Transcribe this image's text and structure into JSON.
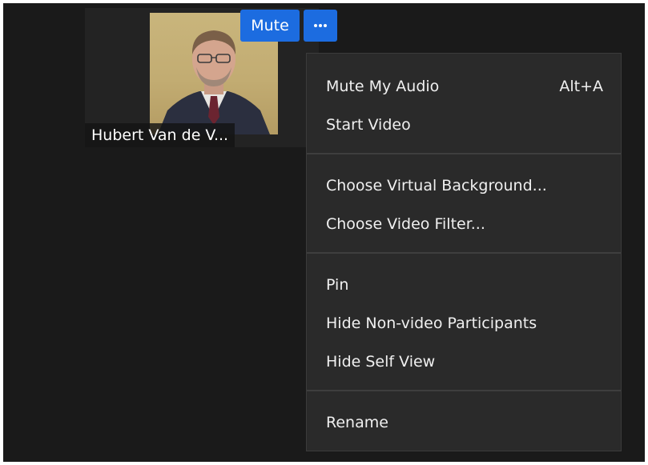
{
  "participant": {
    "name": "Hubert Van de V..."
  },
  "controls": {
    "mute_label": "Mute",
    "more_icon": "ellipsis-icon"
  },
  "menu": {
    "mute_my_audio": "Mute My Audio",
    "mute_my_audio_shortcut": "Alt+A",
    "start_video": "Start Video",
    "choose_virtual_background": "Choose Virtual Background...",
    "choose_video_filter": "Choose Video Filter...",
    "pin": "Pin",
    "hide_non_video_participants": "Hide Non-video Participants",
    "hide_self_view": "Hide Self View",
    "rename": "Rename"
  },
  "colors": {
    "accent": "#1c6ce0",
    "stage_background": "#1a1a1a",
    "menu_background": "#2a2a2a"
  }
}
